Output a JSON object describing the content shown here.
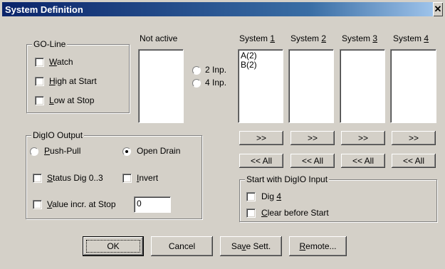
{
  "window": {
    "title": "System Definition",
    "close_glyph": "✕"
  },
  "go_line": {
    "title": "GO-Line",
    "watch": {
      "pre": "",
      "key": "W",
      "post": "atch",
      "checked": false
    },
    "high_at_start": {
      "pre": "",
      "key": "H",
      "post": "igh at Start",
      "checked": false
    },
    "low_at_stop": {
      "pre": "",
      "key": "L",
      "post": "ow at Stop",
      "checked": false
    }
  },
  "not_active": {
    "label": "Not active",
    "items": []
  },
  "inputs": {
    "two": {
      "label": "2 Inp.",
      "selected": false
    },
    "four": {
      "label": "4 Inp.",
      "selected": false
    }
  },
  "systems": [
    {
      "pre": "System ",
      "key": "1",
      "items": [
        "A(2)",
        "B(2)"
      ]
    },
    {
      "pre": "System ",
      "key": "2",
      "items": []
    },
    {
      "pre": "System ",
      "key": "3",
      "items": []
    },
    {
      "pre": "System ",
      "key": "4",
      "items": []
    }
  ],
  "move_buttons": {
    "forward": ">>",
    "back_all": "<< All"
  },
  "digio_output": {
    "title": "DigIO Output",
    "push_pull": {
      "pre": "",
      "key": "P",
      "post": "ush-Pull",
      "selected": false
    },
    "open_drain": {
      "label": "Open Drain",
      "selected": true
    },
    "status_dig": {
      "pre": "",
      "key": "S",
      "post": "tatus Dig 0..3",
      "checked": false
    },
    "invert": {
      "pre": "",
      "key": "I",
      "post": "nvert",
      "checked": false
    },
    "value_incr": {
      "pre": "",
      "key": "V",
      "post": "alue incr. at Stop",
      "checked": false,
      "value": "0"
    }
  },
  "start_with_digio": {
    "title": "Start with DigIO Input",
    "dig4": {
      "pre": "Dig ",
      "key": "4",
      "post": "",
      "checked": false
    },
    "clear_before_start": {
      "pre": "",
      "key": "C",
      "post": "lear before Start",
      "checked": false
    }
  },
  "buttons": {
    "ok": "OK",
    "cancel": "Cancel",
    "save": {
      "pre": "Sa",
      "key": "v",
      "post": "e Sett."
    },
    "remote": {
      "pre": "",
      "key": "R",
      "post": "emote..."
    }
  }
}
